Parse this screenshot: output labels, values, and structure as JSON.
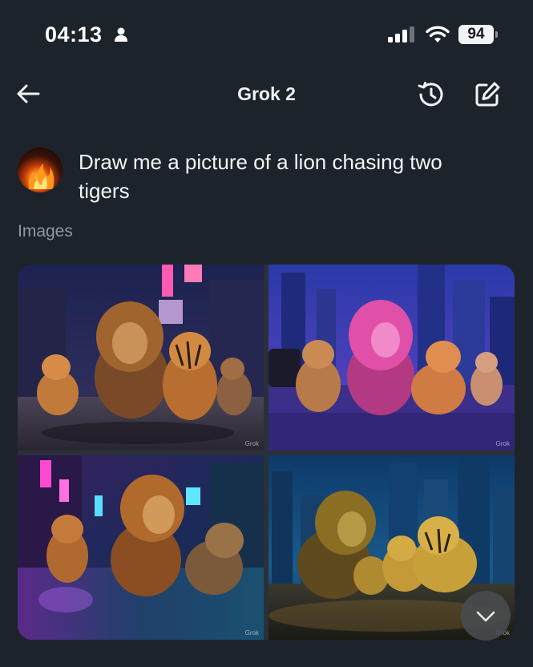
{
  "status_bar": {
    "time": "04:13",
    "battery_level": "94",
    "icons": [
      "person-icon",
      "signal-icon",
      "wifi-icon",
      "battery-icon"
    ]
  },
  "header": {
    "title": "Grok 2",
    "icons": [
      "back-arrow-icon",
      "history-icon",
      "new-chat-icon"
    ]
  },
  "message": {
    "prompt": "Draw me a picture of a lion chasing two tigers"
  },
  "images_section": {
    "label": "Images",
    "images": [
      {
        "watermark": "Grok"
      },
      {
        "watermark": "Grok"
      },
      {
        "watermark": "Grok"
      },
      {
        "watermark": "Grok"
      }
    ]
  },
  "colors": {
    "background": "#1d232b",
    "text_primary": "#f3f5f7",
    "text_secondary": "#8e979f"
  }
}
